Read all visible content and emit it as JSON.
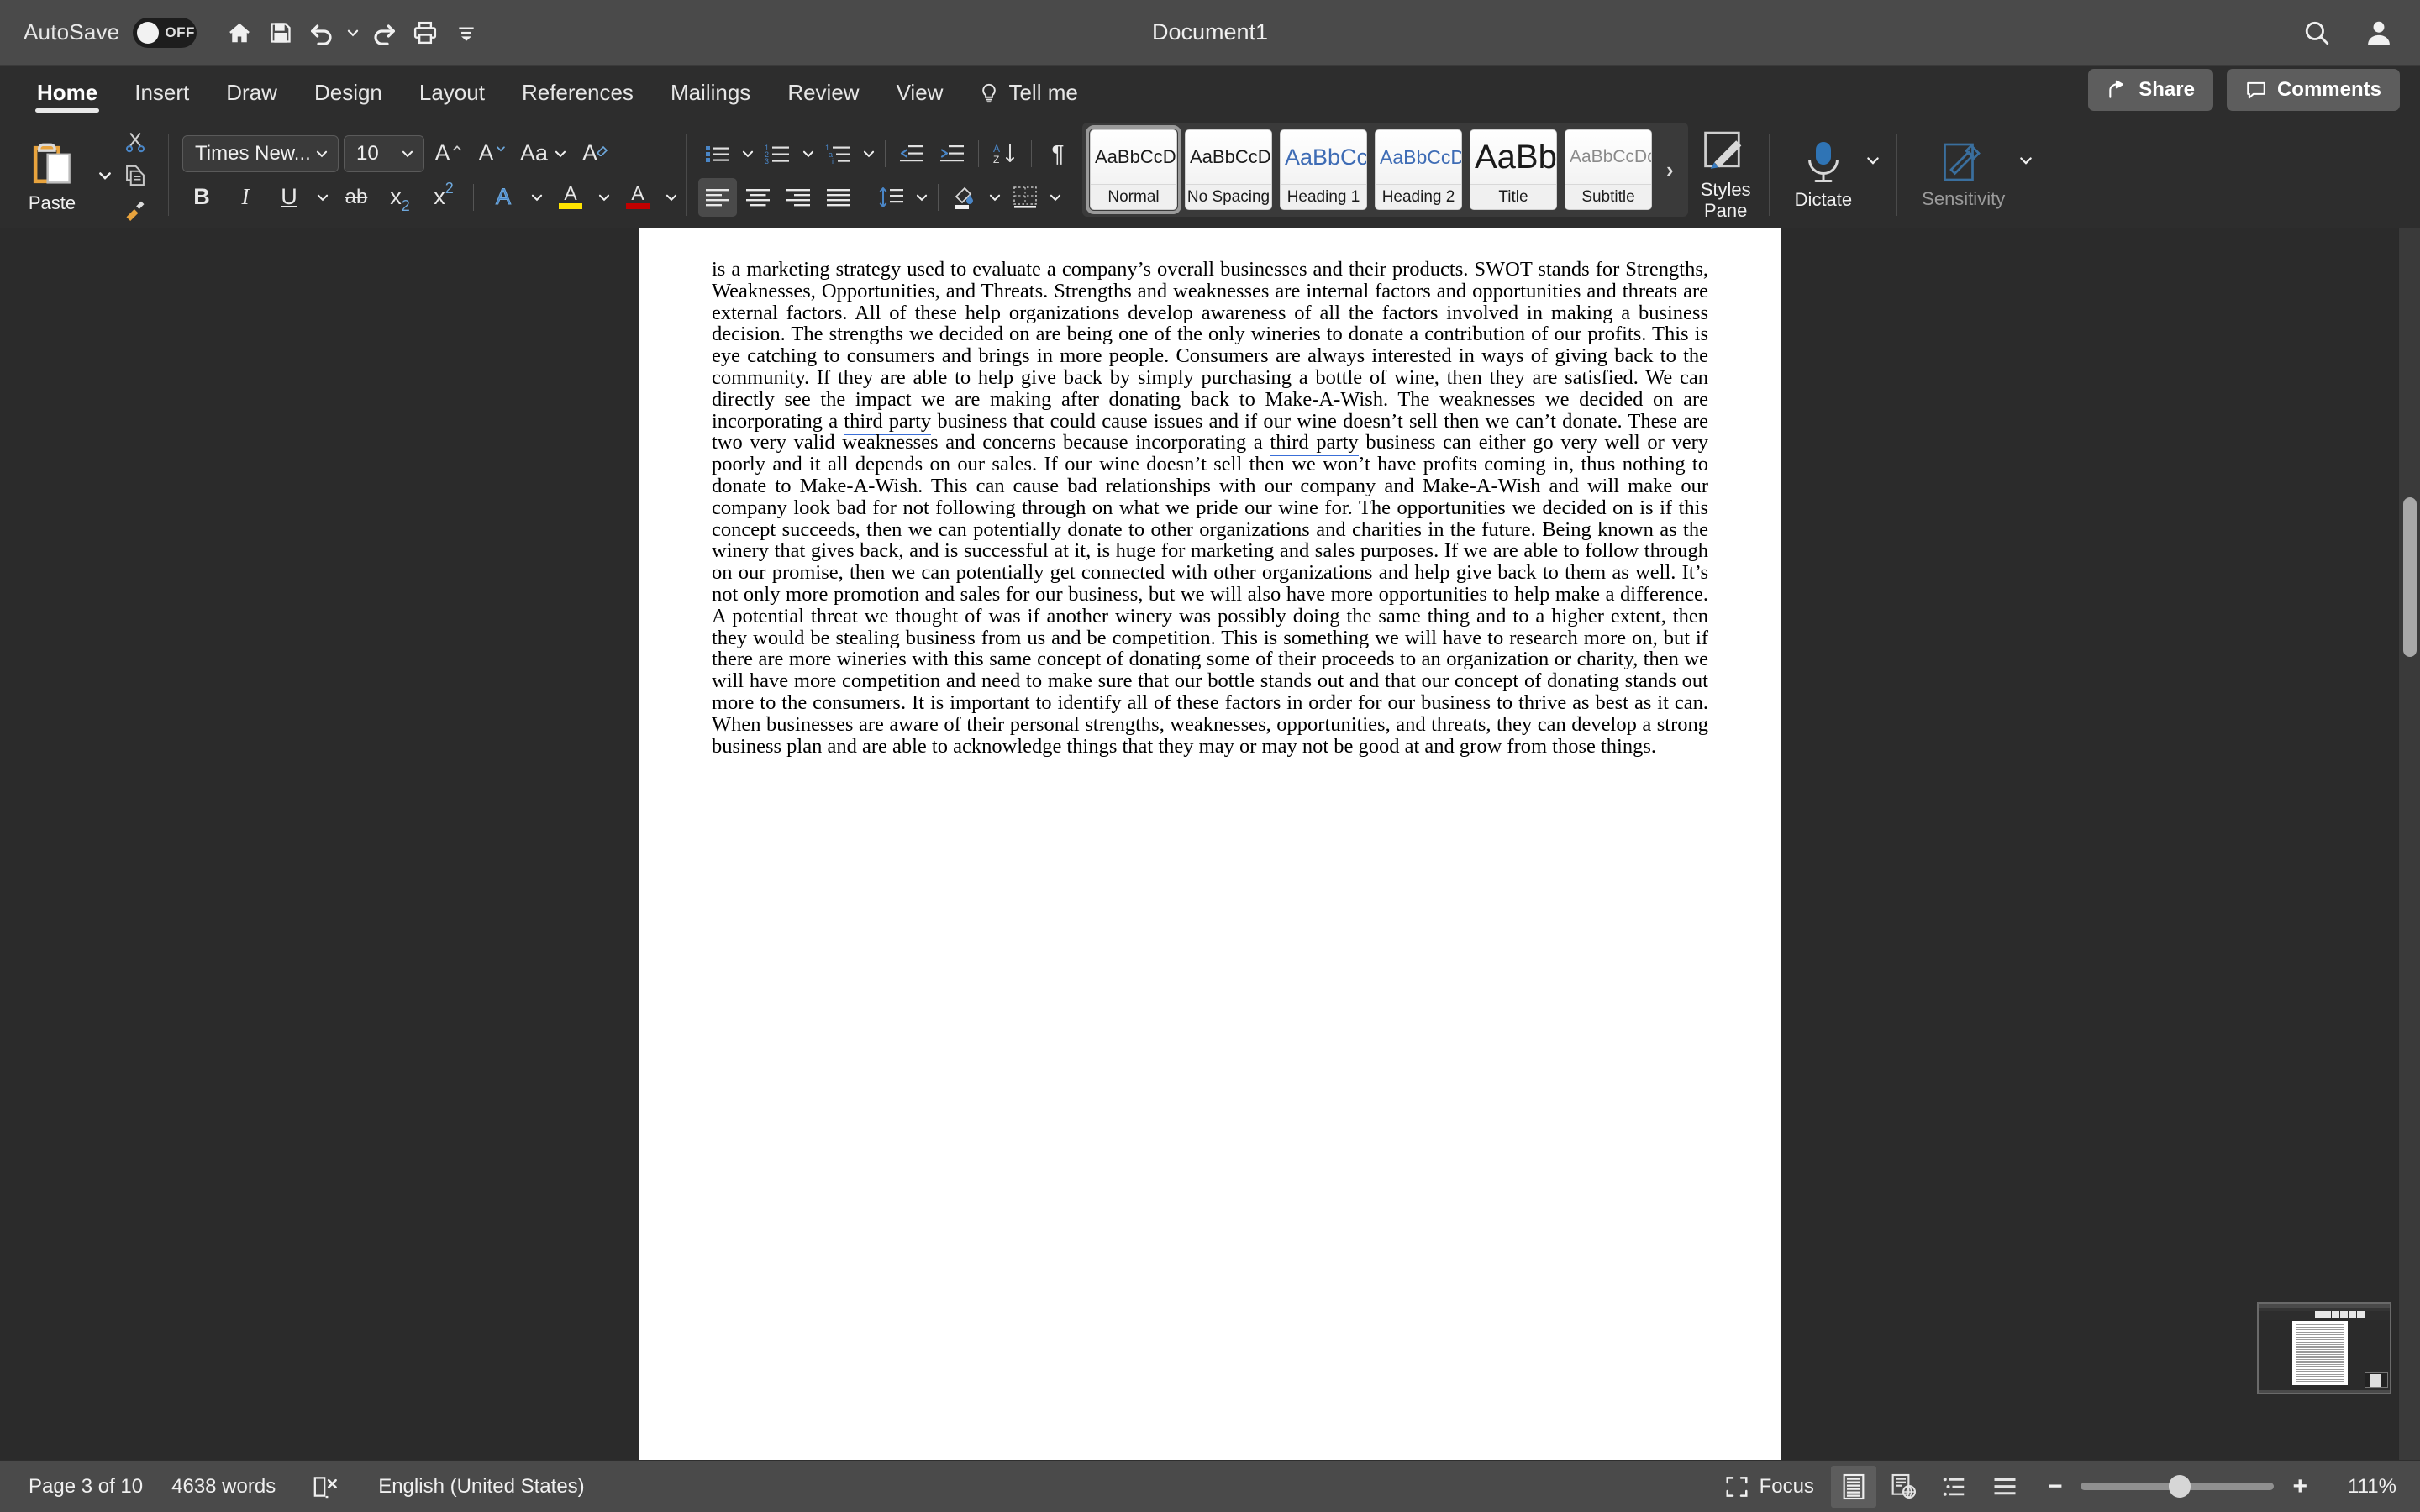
{
  "titlebar": {
    "autosave_label": "AutoSave",
    "autosave_state": "OFF",
    "document_title": "Document1",
    "qat": [
      {
        "name": "home-icon",
        "tip": "Home"
      },
      {
        "name": "save-icon",
        "tip": "Save"
      },
      {
        "name": "undo-icon",
        "tip": "Undo"
      },
      {
        "name": "redo-icon",
        "tip": "Redo"
      },
      {
        "name": "print-icon",
        "tip": "Print"
      },
      {
        "name": "customize-quick-access-icon",
        "tip": "Customize Quick Access Toolbar"
      }
    ],
    "search_icon": "search-icon",
    "account_icon": "account-icon"
  },
  "ribbon_tabs": {
    "items": [
      {
        "label": "Home",
        "active": true
      },
      {
        "label": "Insert",
        "active": false
      },
      {
        "label": "Draw",
        "active": false
      },
      {
        "label": "Design",
        "active": false
      },
      {
        "label": "Layout",
        "active": false
      },
      {
        "label": "References",
        "active": false
      },
      {
        "label": "Mailings",
        "active": false
      },
      {
        "label": "Review",
        "active": false
      },
      {
        "label": "View",
        "active": false
      }
    ],
    "tell_me": "Tell me",
    "share": "Share",
    "comments": "Comments"
  },
  "ribbon": {
    "clipboard": {
      "paste_label": "Paste",
      "cut_icon": "scissors-icon",
      "copy_icon": "copy-icon",
      "format_painter_icon": "format-painter-icon"
    },
    "font": {
      "font_name": "Times New...",
      "font_size": "10",
      "grow_font": "A",
      "shrink_font": "A",
      "change_case": "Aa",
      "clear_formatting": "A",
      "bold": "B",
      "italic": "I",
      "underline": "U",
      "strikethrough": "ab",
      "subscript": "x",
      "superscript": "x",
      "text_effects": "A",
      "highlight": "A",
      "font_color": "A",
      "highlight_color": "#ffe400",
      "font_color_swatch": "#c00000",
      "accent_blue": "#2e7cd6"
    },
    "paragraph": {
      "bullets_icon": "bulleted-list-icon",
      "numbering_icon": "numbered-list-icon",
      "multilevel_icon": "multilevel-list-icon",
      "decrease_indent_icon": "decrease-indent-icon",
      "increase_indent_icon": "increase-indent-icon",
      "sort_icon": "sort-az-icon",
      "show_marks_icon": "pilcrow-icon",
      "align_left_icon": "align-left-icon",
      "align_center_icon": "align-center-icon",
      "align_right_icon": "align-right-icon",
      "justify_icon": "justify-icon",
      "line_spacing_icon": "line-spacing-icon",
      "shading_icon": "shading-icon",
      "borders_icon": "borders-icon"
    },
    "styles": [
      {
        "preview": "AaBbCcDdEe",
        "name": "Normal",
        "selected": true,
        "color": "#1a1a1a",
        "size": "22px",
        "weight": "normal"
      },
      {
        "preview": "AaBbCcDdEe",
        "name": "No Spacing",
        "selected": false,
        "color": "#1a1a1a",
        "size": "22px",
        "weight": "normal"
      },
      {
        "preview": "AaBbCcDc",
        "name": "Heading 1",
        "selected": false,
        "color": "#3e6cb5",
        "size": "26px",
        "weight": "normal"
      },
      {
        "preview": "AaBbCcDdE",
        "name": "Heading 2",
        "selected": false,
        "color": "#3e6cb5",
        "size": "23px",
        "weight": "normal"
      },
      {
        "preview": "AaBbC",
        "name": "Title",
        "selected": false,
        "color": "#1a1a1a",
        "size": "38px",
        "weight": "normal"
      },
      {
        "preview": "AaBbCcDdEe",
        "name": "Subtitle",
        "selected": false,
        "color": "#7a7a7a",
        "size": "22px",
        "weight": "normal"
      }
    ],
    "gallery_more": "›",
    "styles_pane_label": "Styles\nPane",
    "styles_pane_line1": "Styles",
    "styles_pane_line2": "Pane",
    "dictate_label": "Dictate",
    "sensitivity_label": "Sensitivity"
  },
  "document": {
    "paragraph_parts": [
      {
        "t": "is a marketing strategy used to evaluate a company’s overall businesses and their products. SWOT stands for Strengths, Weaknesses, Opportunities, and Threats. Strengths and weaknesses are internal factors and opportunities and threats are external factors. All of these help organizations develop awareness of all the factors involved in making a business decision. The strengths we decided on are being one of the only wineries to donate a contribution of our profits. This is eye catching to consumers and brings in more people. Consumers are always interested in ways of giving back to the community. If they are able to help give back by simply purchasing a bottle of wine, then they are satisfied. We can directly see the impact we are making after donating back to Make-A-Wish. The weaknesses we decided on are incorporating a ",
        "grammar": false
      },
      {
        "t": "third party",
        "grammar": true
      },
      {
        "t": " business that could cause issues and if our wine doesn’t sell then we can’t donate. These are two very valid weaknesses and concerns because incorporating a ",
        "grammar": false
      },
      {
        "t": "third party",
        "grammar": true
      },
      {
        "t": " business can either go very well or very poorly and it all depends on our sales. If our wine doesn’t sell then we won’t have profits coming in, thus nothing to donate to Make-A-Wish. This can cause bad relationships with our company and Make-A-Wish and will make our company look bad for not following through on what we pride our wine for. The opportunities we decided on is if this concept succeeds, then we can potentially donate to other organizations and charities in the future. Being known as the winery that gives back, and is successful at it, is huge for marketing and sales purposes. If we are able to follow through on our promise, then we can potentially get connected with other organizations and help give back to them as well. It’s not only more promotion and sales for our business, but we will also have more opportunities to help make a difference. A potential threat we thought of was if another winery was possibly doing the same thing and to a higher extent, then they would be stealing business from us and be competition. This is something we will have to research more on, but if there are more wineries with this same concept of donating some of their proceeds to an organization or charity, then we will have more competition and need to make sure that our bottle stands out and that our concept of donating stands out more to the consumers. It is important to identify all of these factors in order for our business to thrive as best as it can. When businesses are aware of their personal strengths, weaknesses, opportunities, and threats, they can develop a strong business plan and are able to acknowledge things that they may or may not be good at and grow from those things.",
        "grammar": false
      }
    ]
  },
  "statusbar": {
    "page_indicator": "Page 3 of 10",
    "word_count": "4638 words",
    "proofing_icon": "proofing-errors-icon",
    "language": "English (United States)",
    "focus_label": "Focus",
    "focus_icon": "focus-mode-icon",
    "view_print_layout_icon": "print-layout-icon",
    "view_web_layout_icon": "web-layout-icon",
    "view_outline_icon": "outline-view-icon",
    "view_draft_icon": "draft-view-icon",
    "zoom_out": "−",
    "zoom_in": "+",
    "zoom_level": "111%"
  }
}
